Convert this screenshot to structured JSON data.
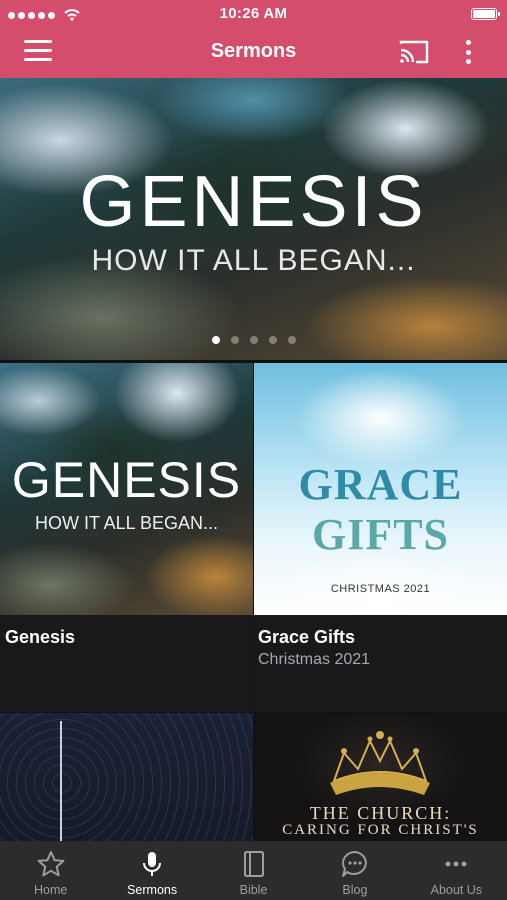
{
  "status_bar": {
    "time": "10:26 AM",
    "signal_dots": 5,
    "icons": [
      "signal-dots-icon",
      "wifi-icon",
      "battery-icon"
    ]
  },
  "header": {
    "title": "Sermons",
    "icons": [
      "hamburger-menu-icon",
      "cast-icon",
      "more-vertical-icon"
    ],
    "background": "#d44d6c"
  },
  "hero": {
    "title": "GENESIS",
    "subtitle": "HOW IT ALL BEGAN...",
    "slide_count": 5,
    "active_slide": 1
  },
  "sermons": [
    {
      "name": "Genesis",
      "subtitle": "",
      "art": {
        "line1": "GENESIS",
        "line2": "HOW IT ALL BEGAN..."
      }
    },
    {
      "name": "Grace Gifts",
      "subtitle": "Christmas 2021",
      "art": {
        "line1": "GRACE",
        "line2": "GIFTS",
        "line3": "CHRISTMAS 2021"
      }
    },
    {
      "name": "",
      "subtitle": "",
      "art": {}
    },
    {
      "name": "",
      "subtitle": "",
      "art": {
        "line1": "THE CHURCH:",
        "line2": "CARING FOR CHRIST'S"
      }
    }
  ],
  "tab_bar": {
    "tabs": [
      {
        "label": "Home",
        "icon": "star-icon",
        "active": false
      },
      {
        "label": "Sermons",
        "icon": "microphone-icon",
        "active": true
      },
      {
        "label": "Bible",
        "icon": "book-icon",
        "active": false
      },
      {
        "label": "Blog",
        "icon": "chat-bubble-icon",
        "active": false
      },
      {
        "label": "About Us",
        "icon": "ellipsis-icon",
        "active": false
      }
    ],
    "active_color": "#ffffff",
    "inactive_color": "#9c9ca1"
  }
}
